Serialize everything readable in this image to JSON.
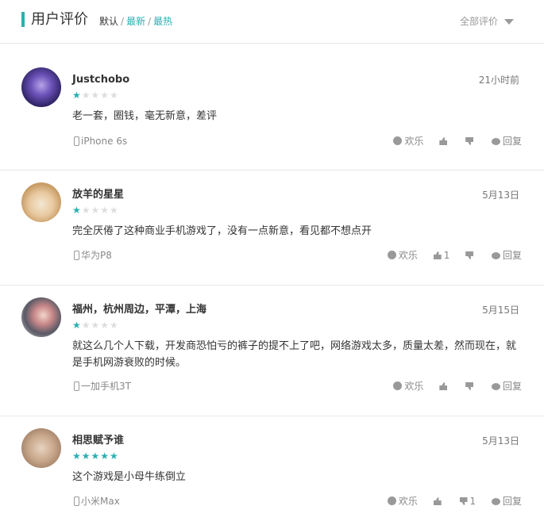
{
  "header": {
    "title": "用户评价",
    "sort_default": "默认",
    "sort_newest": "最新",
    "sort_hottest": "最热",
    "sort_sep": "/",
    "filter": "全部评价"
  },
  "reviews": [
    {
      "username": "Justchobo",
      "time": "21小时前",
      "rating": 1,
      "stars_on": "★",
      "stars_off": "★★★★",
      "text": "老一套，圈钱，毫无新意，差评",
      "device": "iPhone 6s",
      "happy_label": "欢乐",
      "likes": "",
      "dislikes": "",
      "reply_label": "回复"
    },
    {
      "username": "放羊的星星",
      "time": "5月13日",
      "rating": 1,
      "stars_on": "★",
      "stars_off": "★★★★",
      "text": "完全厌倦了这种商业手机游戏了，没有一点新意，看见都不想点开",
      "device": "华为P8",
      "happy_label": "欢乐",
      "likes": "1",
      "dislikes": "",
      "reply_label": "回复"
    },
    {
      "username": "福州，杭州周边，平潭，上海",
      "time": "5月15日",
      "rating": 1,
      "stars_on": "★",
      "stars_off": "★★★★",
      "text": "就这么几个人下载，开发商恐怕亏的裤子的提不上了吧，网络游戏太多，质量太差，然而现在，就是手机网游衰败的时候。",
      "device": "一加手机3T",
      "happy_label": "欢乐",
      "likes": "",
      "dislikes": "",
      "reply_label": "回复"
    },
    {
      "username": "相思赋予谁",
      "time": "5月13日",
      "rating": 5,
      "stars_on": "★★★★★",
      "stars_off": "",
      "text": "这个游戏是小母牛练倒立",
      "device": "小米Max",
      "happy_label": "欢乐",
      "likes": "",
      "dislikes": "1",
      "reply_label": "回复"
    }
  ],
  "colors": {
    "accent": "#2ab0b1",
    "star_off": "#dddddd"
  },
  "icons": [
    "smile-icon",
    "thumbs-up-icon",
    "thumbs-down-icon",
    "comment-icon",
    "phone-icon",
    "caret-down-icon"
  ]
}
